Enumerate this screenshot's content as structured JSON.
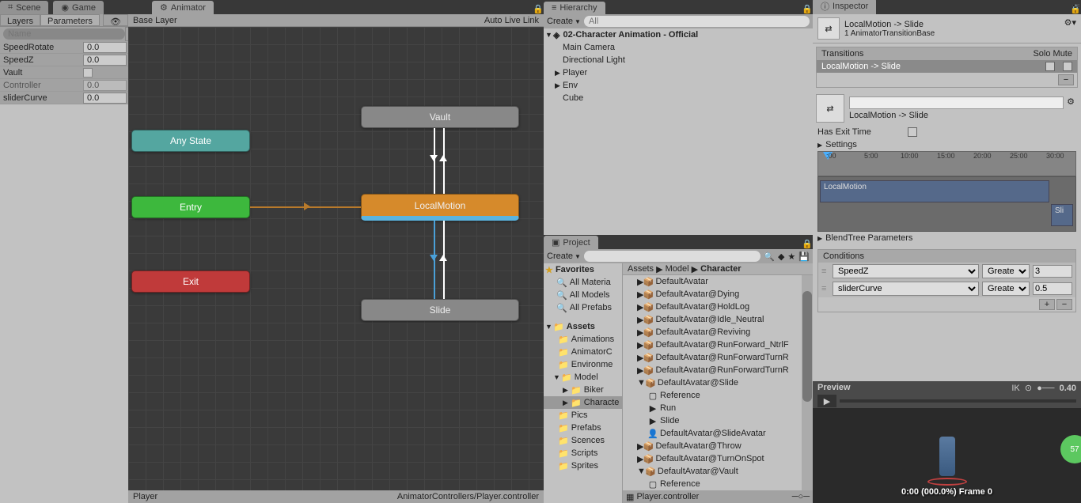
{
  "tabs": {
    "scene": "Scene",
    "game": "Game",
    "animator": "Animator",
    "hierarchy": "Hierarchy",
    "project": "Project",
    "inspector": "Inspector"
  },
  "animator": {
    "subtab_layers": "Layers",
    "subtab_parameters": "Parameters",
    "search_placeholder": "Name",
    "params": [
      {
        "name": "SpeedRotate",
        "value": "0.0",
        "type": "float"
      },
      {
        "name": "SpeedZ",
        "value": "0.0",
        "type": "float"
      },
      {
        "name": "Vault",
        "value": "",
        "type": "bool"
      },
      {
        "name": "Controller",
        "value": "0.0",
        "type": "float",
        "disabled": true
      },
      {
        "name": "sliderCurve",
        "value": "0.0",
        "type": "float"
      }
    ],
    "breadcrumb": "Base Layer",
    "autolive": "Auto Live Link",
    "nodes": {
      "anystate": "Any State",
      "entry": "Entry",
      "exit": "Exit",
      "vault": "Vault",
      "local": "LocalMotion",
      "slide": "Slide"
    },
    "status_left": "Player",
    "status_right": "AnimatorControllers/Player.controller"
  },
  "hierarchy": {
    "create": "Create",
    "search_placeholder": "All",
    "root": "02-Character Animation - Official",
    "items": [
      "Main Camera",
      "Directional Light",
      "Player",
      "Env",
      "Cube"
    ]
  },
  "project": {
    "create": "Create",
    "favorites": "Favorites",
    "fav_items": [
      "All Materia",
      "All Models",
      "All Prefabs"
    ],
    "assets": "Assets",
    "folders": [
      "Animations",
      "AnimatorC",
      "Environme",
      "Model",
      "Pics",
      "Prefabs",
      "Scences",
      "Scripts",
      "Sprites"
    ],
    "model_sub": [
      "Biker",
      "Characte"
    ],
    "crumb": [
      "Assets",
      "Model",
      "Character"
    ],
    "files": [
      {
        "n": "DefaultAvatar",
        "d": 1
      },
      {
        "n": "DefaultAvatar@Dying",
        "d": 1
      },
      {
        "n": "DefaultAvatar@HoldLog",
        "d": 1
      },
      {
        "n": "DefaultAvatar@Idle_Neutral",
        "d": 1
      },
      {
        "n": "DefaultAvatar@Reviving",
        "d": 1
      },
      {
        "n": "DefaultAvatar@RunForward_NtrlF",
        "d": 1
      },
      {
        "n": "DefaultAvatar@RunForwardTurnR",
        "d": 1
      },
      {
        "n": "DefaultAvatar@RunForwardTurnR",
        "d": 1
      },
      {
        "n": "DefaultAvatar@Slide",
        "d": 1,
        "exp": true
      },
      {
        "n": "Reference",
        "d": 2,
        "icon": "box"
      },
      {
        "n": "Run",
        "d": 2,
        "icon": "clip"
      },
      {
        "n": "Slide",
        "d": 2,
        "icon": "clip"
      },
      {
        "n": "DefaultAvatar@SlideAvatar",
        "d": 2,
        "icon": "avatar"
      },
      {
        "n": "DefaultAvatar@Throw",
        "d": 1
      },
      {
        "n": "DefaultAvatar@TurnOnSpot",
        "d": 1
      },
      {
        "n": "DefaultAvatar@Vault",
        "d": 1,
        "exp": true
      },
      {
        "n": "Reference",
        "d": 2,
        "icon": "box"
      }
    ],
    "foot": "Player.controller"
  },
  "inspector": {
    "title": "LocalMotion -> Slide",
    "subtitle": "1 AnimatorTransitionBase",
    "trans_header": "Transitions",
    "solo": "Solo",
    "mute": "Mute",
    "trans_item": "LocalMotion -> Slide",
    "name_label": "LocalMotion -> Slide",
    "exit_time": "Has Exit Time",
    "settings": "Settings",
    "blendtree": "BlendTree Parameters",
    "ticks": [
      ":00",
      "5:00",
      "10:00",
      "15:00",
      "20:00",
      "25:00",
      "30:00"
    ],
    "clip_local": "LocalMotion",
    "clip_slide": "Sli",
    "cond_header": "Conditions",
    "conditions": [
      {
        "param": "SpeedZ",
        "op": "Greater",
        "val": "3"
      },
      {
        "param": "sliderCurve",
        "op": "Greater",
        "val": "0.5"
      }
    ],
    "preview": "Preview",
    "preview_val": "0.40",
    "preview_foot": "0:00 (000.0%) Frame 0",
    "green": "57"
  }
}
